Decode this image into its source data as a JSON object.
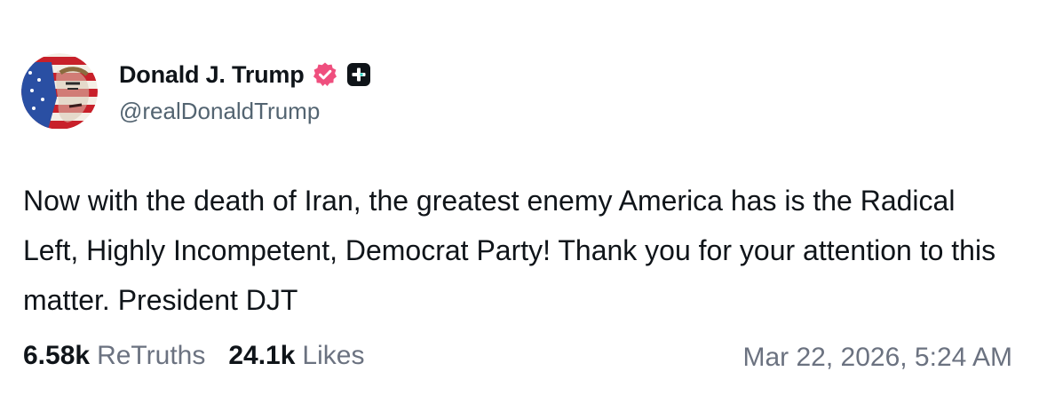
{
  "author": {
    "display_name": "Donald J. Trump",
    "handle": "@realDonaldTrump",
    "verified_icon": "verified-check-icon",
    "plus_icon": "plus-badge-icon",
    "badge_color": "#ef4f7e"
  },
  "post": {
    "text": "Now with the death of Iran, the greatest enemy America has is the Radical Left, Highly Incompetent, Democrat Party! Thank you for your attention to this matter. President DJT"
  },
  "stats": {
    "retruths_count": "6.58k",
    "retruths_label": "ReTruths",
    "likes_count": "24.1k",
    "likes_label": "Likes"
  },
  "timestamp": "Mar 22, 2026, 5:24 AM"
}
